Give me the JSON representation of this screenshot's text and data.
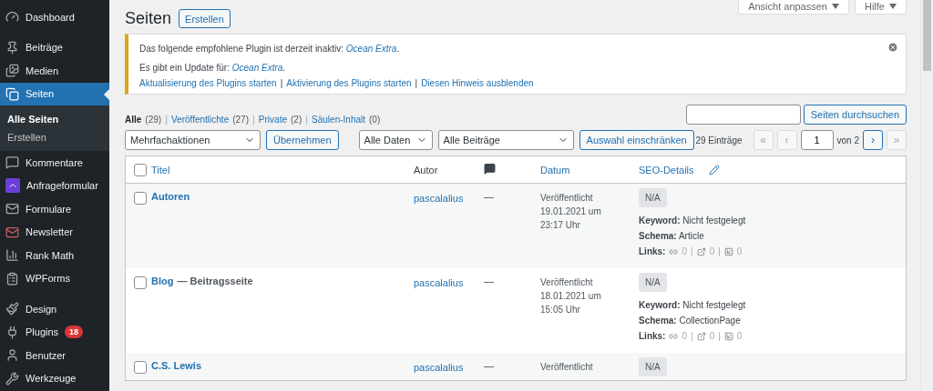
{
  "sidebar": {
    "groups": [
      [
        {
          "label": "Dashboard",
          "selected": false
        }
      ],
      [
        {
          "label": "Beiträge",
          "selected": false
        },
        {
          "label": "Medien",
          "selected": false
        },
        {
          "label": "Seiten",
          "selected": true,
          "submenu": [
            {
              "label": "Alle Seiten",
              "selected": true
            },
            {
              "label": "Erstellen",
              "selected": false
            }
          ]
        },
        {
          "label": "Kommentare",
          "selected": false
        },
        {
          "label": "Anfrageformular",
          "selected": false
        },
        {
          "label": "Formulare",
          "selected": false
        },
        {
          "label": "Newsletter",
          "selected": false
        },
        {
          "label": "Rank Math",
          "selected": false
        },
        {
          "label": "WPForms",
          "selected": false
        }
      ],
      [
        {
          "label": "Design",
          "selected": false
        },
        {
          "label": "Plugins",
          "selected": false,
          "badge": "18"
        },
        {
          "label": "Benutzer",
          "selected": false
        },
        {
          "label": "Werkzeuge",
          "selected": false
        }
      ]
    ]
  },
  "screen_meta": [
    "Ansicht anpassen",
    "Hilfe"
  ],
  "page": {
    "title": "Seiten",
    "add_button": "Erstellen"
  },
  "notice": {
    "lines": [
      {
        "text": "Das folgende empfohlene Plugin ist derzeit inaktiv: ",
        "link": "Ocean Extra",
        "end": "."
      },
      {
        "text": "Es gibt ein Update für: ",
        "link": "Ocean Extra",
        "end": "."
      }
    ],
    "actions": [
      "Aktualisierung des Plugins starten",
      "Aktivierung des Plugins starten",
      "Diesen Hinweis ausblenden"
    ],
    "separator": "|"
  },
  "views": {
    "separator": "|",
    "items": [
      {
        "label": "Alle",
        "count": "(29)",
        "selected": true
      },
      {
        "label": "Veröffentlichte",
        "count": "(27)",
        "selected": false
      },
      {
        "label": "Private",
        "count": "(2)",
        "selected": false
      },
      {
        "label": "Säulen-Inhalt",
        "count": "(0)",
        "selected": false
      }
    ]
  },
  "search": {
    "button": "Seiten durchsuchen"
  },
  "tablenav": {
    "bulk_select": "Mehrfachaktionen",
    "apply": "Übernehmen",
    "filters": [
      "Alle Daten",
      "Alle Beiträge"
    ],
    "filter_button": "Auswahl einschränken"
  },
  "pagination": {
    "count": "29 Einträge",
    "current": "1",
    "of": "von 2",
    "buttons": [
      {
        "label": "«",
        "disabled": true
      },
      {
        "label": "‹",
        "disabled": true
      },
      {
        "label": "›",
        "disabled": false
      },
      {
        "label": "»",
        "disabled": true
      }
    ]
  },
  "table": {
    "select_all": {
      "checked": false
    },
    "columns": [
      {
        "kind": "title",
        "label": "Titel",
        "sortable": true
      },
      {
        "kind": "author",
        "label": "Autor",
        "sortable": false
      },
      {
        "kind": "comments"
      },
      {
        "kind": "date",
        "label": "Datum",
        "sortable": true
      },
      {
        "kind": "seo",
        "label": "SEO-Details",
        "sortable": true
      }
    ],
    "rows": [
      {
        "title": "Autoren",
        "checked": false,
        "author": "pascalalius",
        "comments": "—",
        "date": [
          "Veröffentlicht",
          "19.01.2021 um",
          "23:17 Uhr"
        ],
        "seo": {
          "score": "N/A",
          "keyword": "**Keyword:** Nicht festgelegt",
          "schema": "**Schema:** Article",
          "links_label": "Links:",
          "links": [
            "0",
            "0",
            "0"
          ],
          "separator": "|"
        }
      },
      {
        "title": "Blog",
        "post_state": "— Beitragsseite",
        "checked": false,
        "author": "pascalalius",
        "comments": "—",
        "date": [
          "Veröffentlicht",
          "18.01.2021 um",
          "15:05 Uhr"
        ],
        "seo": {
          "score": "N/A",
          "keyword": "**Keyword:** Nicht festgelegt",
          "schema": "**Schema:** CollectionPage",
          "links_label": "Links:",
          "links": [
            "0",
            "0",
            "0"
          ],
          "separator": "|"
        }
      },
      {
        "title": "C.S. Lewis",
        "checked": false,
        "author": "pascalalius",
        "comments": "—",
        "date": [
          "Veröffentlicht"
        ],
        "seo": {
          "score": "N/A"
        }
      }
    ]
  }
}
